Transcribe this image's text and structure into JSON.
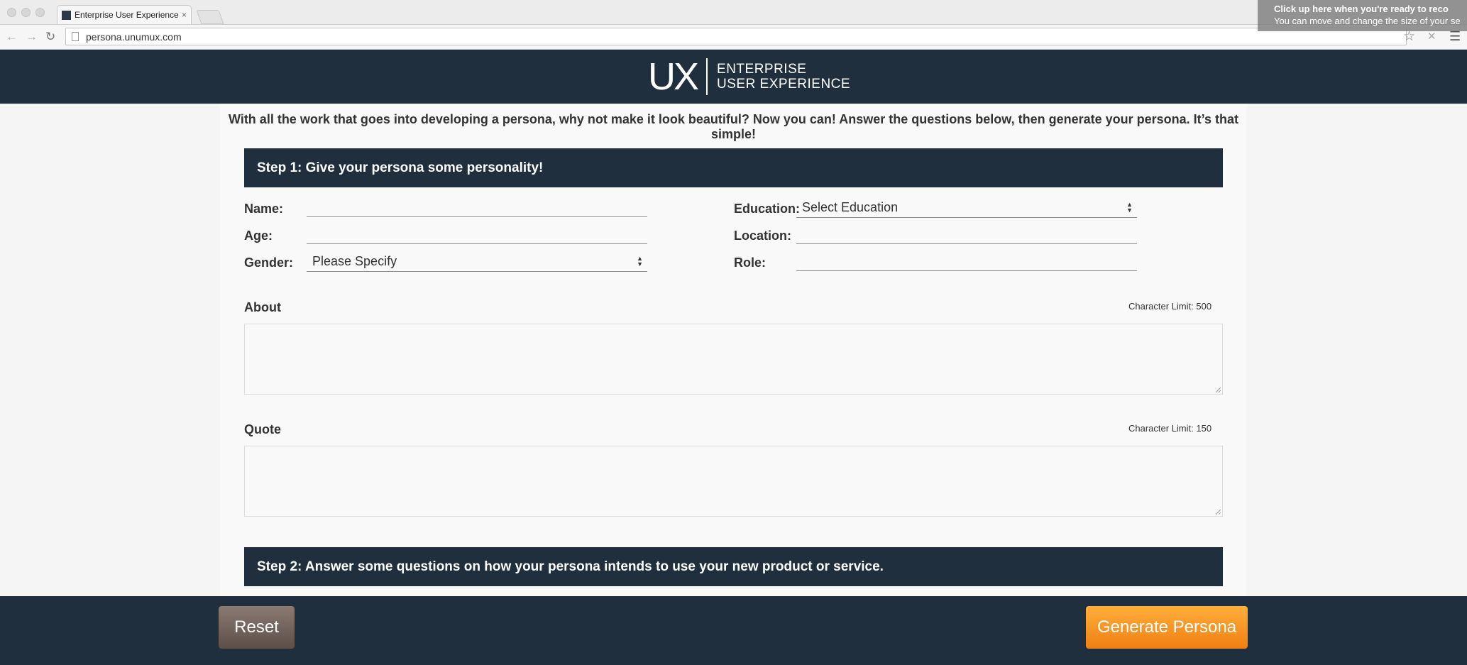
{
  "browser": {
    "tab_title": "Enterprise User Experience",
    "tab_close": "×",
    "url": "persona.unumux.com",
    "overlay_line1": "Click up here when you're ready to reco",
    "overlay_line2": "You can move and change the size of your se"
  },
  "header": {
    "logo_mark": "UX",
    "logo_line1": "ENTERPRISE",
    "logo_line2": "USER EXPERIENCE"
  },
  "intro": "With all the work that goes into developing a persona, why not make it look beautiful? Now you can! Answer the questions below, then generate your persona. It’s that simple!",
  "step1": {
    "title": "Step 1: Give your persona some personality!",
    "name_label": "Name:",
    "age_label": "Age:",
    "gender_label": "Gender:",
    "gender_value": "Please Specify",
    "education_label": "Education:",
    "education_value": "Select Education",
    "location_label": "Location:",
    "role_label": "Role:",
    "about_label": "About",
    "about_limit": "Character Limit: 500",
    "quote_label": "Quote",
    "quote_limit": "Character Limit: 150"
  },
  "step2": {
    "title": "Step 2: Answer some questions on how your persona intends to use your new product or service."
  },
  "footer": {
    "reset_label": "Reset",
    "generate_label": "Generate Persona"
  },
  "colors": {
    "navy": "#1f2f3d",
    "orange": "#f79a27",
    "reset_brown": "#6f615a"
  }
}
